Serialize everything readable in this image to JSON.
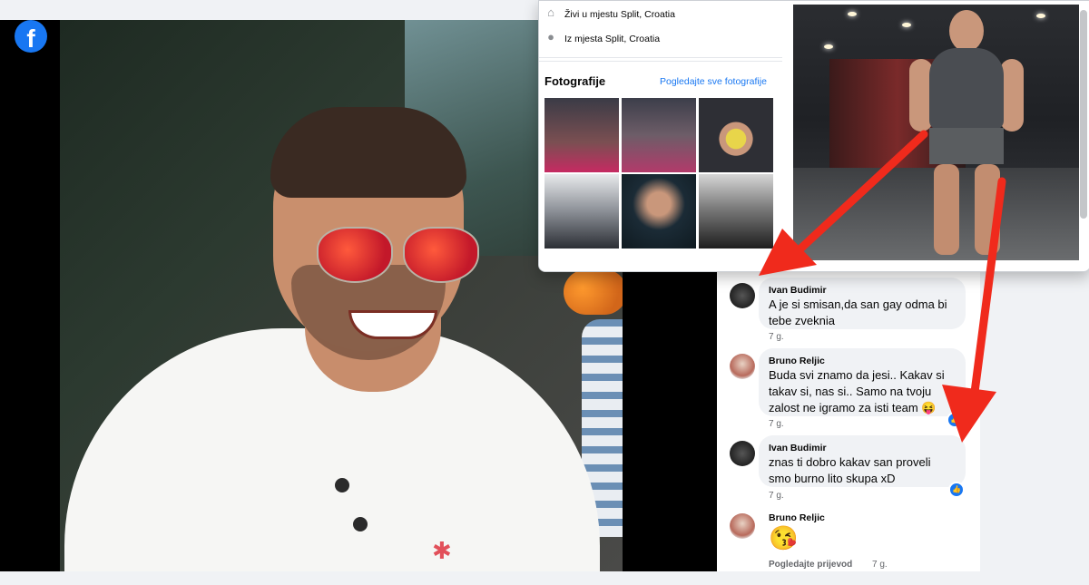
{
  "profile_info": {
    "lives_in": "Živi u mjestu Split, Croatia",
    "from": "Iz mjesta Split, Croatia"
  },
  "photos": {
    "title": "Fotografije",
    "see_all": "Pogledajte sve fotografije"
  },
  "comments": [
    {
      "author": "Ivan Budimir",
      "text": "A je si smisan,da san gay odma bi tebe zveknia",
      "time": "7 g."
    },
    {
      "author": "Bruno Reljic",
      "text": "Buda svi znamo da jesi.. Kakav si takav si, nas si.. Samo na tvoju zalost ne igramo za isti team 😝",
      "time": "7 g."
    },
    {
      "author": "Ivan Budimir",
      "text": "znas ti dobro kakav san proveli smo burno lito skupa xD",
      "time": "7 g."
    },
    {
      "author": "Bruno Reljic",
      "text": "😘",
      "time": "7 g.",
      "action": "Pogledajte prijevod"
    }
  ],
  "colors": {
    "accent": "#1877f2",
    "arrow": "#f02a1c"
  },
  "icons": {
    "facebook": "f",
    "home": "⌂",
    "pin": "●",
    "like": "👍"
  }
}
